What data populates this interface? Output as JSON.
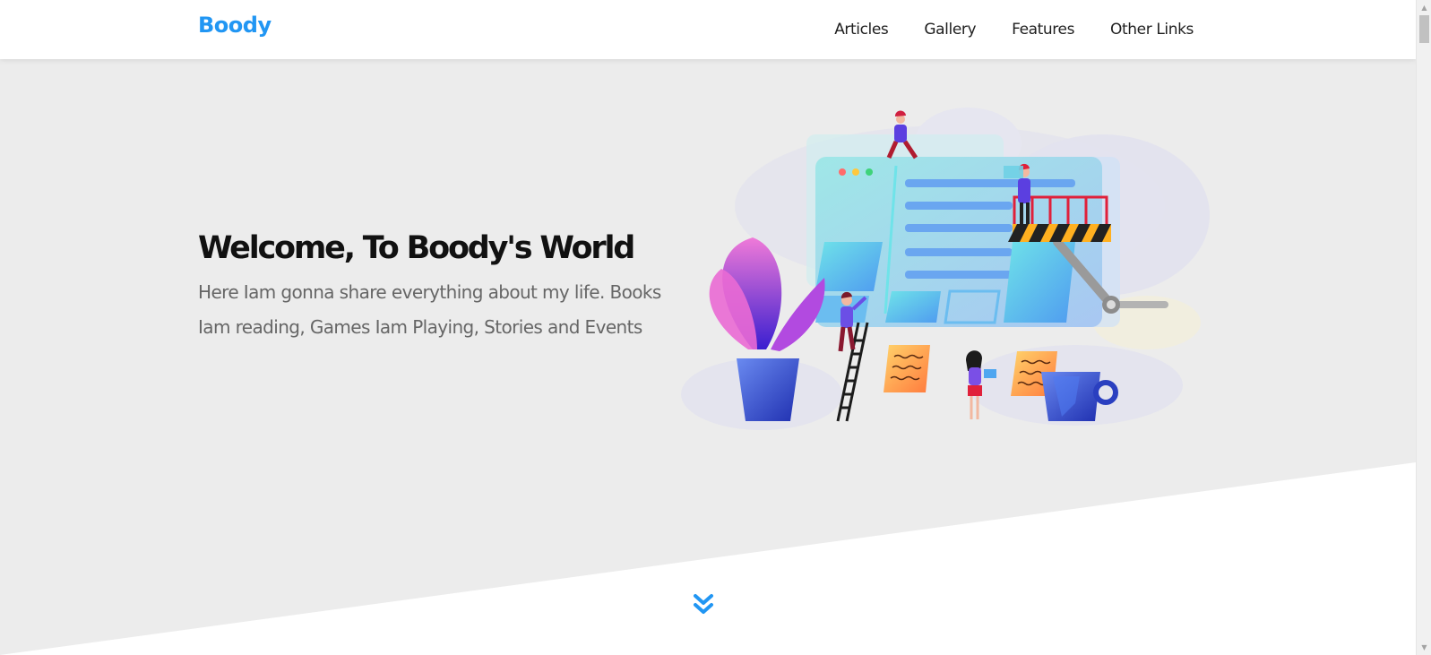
{
  "header": {
    "logo": "Boody",
    "nav": [
      {
        "label": "Articles"
      },
      {
        "label": "Gallery"
      },
      {
        "label": "Features"
      },
      {
        "label": "Other Links"
      }
    ]
  },
  "hero": {
    "title": "Welcome, To Boody's World",
    "description": "Here Iam gonna share everything about my life. Books Iam reading, Games Iam Playing, Stories and Events"
  },
  "colors": {
    "brand": "#2196f3",
    "hero_bg": "#ececec",
    "text_dark": "#111111",
    "text_muted": "#666666"
  },
  "icons": {
    "scroll_down": "double-chevron-down-icon",
    "illustration": "website-building-illustration"
  }
}
